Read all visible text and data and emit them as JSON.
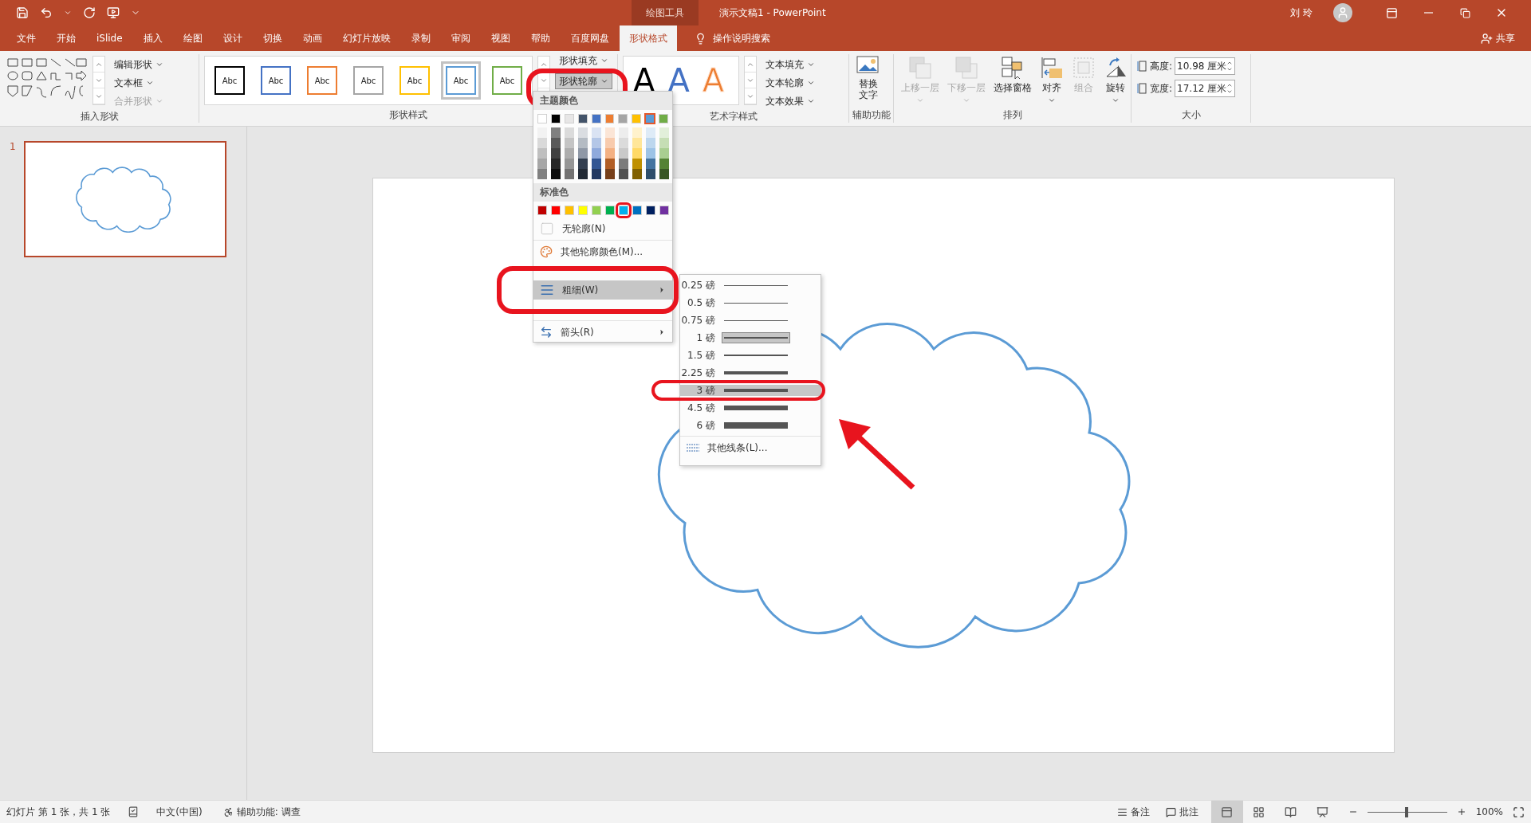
{
  "title_bar": {
    "contextual_tab": "绘图工具",
    "document_title": "演示文稿1  -  PowerPoint",
    "user_name": "刘 玲"
  },
  "tabs": [
    {
      "label": "文件",
      "selected": false
    },
    {
      "label": "开始",
      "selected": false
    },
    {
      "label": "iSlide",
      "selected": false
    },
    {
      "label": "插入",
      "selected": false
    },
    {
      "label": "绘图",
      "selected": false
    },
    {
      "label": "设计",
      "selected": false
    },
    {
      "label": "切换",
      "selected": false
    },
    {
      "label": "动画",
      "selected": false
    },
    {
      "label": "幻灯片放映",
      "selected": false
    },
    {
      "label": "录制",
      "selected": false
    },
    {
      "label": "审阅",
      "selected": false
    },
    {
      "label": "视图",
      "selected": false
    },
    {
      "label": "帮助",
      "selected": false
    },
    {
      "label": "百度网盘",
      "selected": false
    },
    {
      "label": "形状格式",
      "selected": true
    }
  ],
  "tell_me": "操作说明搜索",
  "share": "共享",
  "ribbon": {
    "insert_shapes": {
      "label": "插入形状",
      "commands": [
        {
          "label": "编辑形状",
          "disabled": false
        },
        {
          "label": "文本框",
          "disabled": false
        },
        {
          "label": "合并形状",
          "disabled": true
        }
      ]
    },
    "shape_styles": {
      "label": "形状样式",
      "styles": [
        {
          "label": "Abc",
          "color": "#000000",
          "selected": false
        },
        {
          "label": "Abc",
          "color": "#4472c4",
          "selected": false
        },
        {
          "label": "Abc",
          "color": "#ed7d31",
          "selected": false
        },
        {
          "label": "Abc",
          "color": "#a5a5a5",
          "selected": false
        },
        {
          "label": "Abc",
          "color": "#ffc000",
          "selected": false
        },
        {
          "label": "Abc",
          "color": "#5b9bd5",
          "selected": true
        },
        {
          "label": "Abc",
          "color": "#70ad47",
          "selected": false
        }
      ],
      "commands": [
        {
          "label": "形状填充",
          "pressed": false
        },
        {
          "label": "形状轮廓",
          "pressed": true
        }
      ]
    },
    "wordart_styles": {
      "label": "艺术字样式",
      "presets": [
        {
          "text": "A",
          "color": "#000000",
          "kind": "fill"
        },
        {
          "text": "A",
          "color": "#4472c4",
          "kind": "fill"
        },
        {
          "text": "A",
          "color": "#ed7d31",
          "kind": "outline"
        }
      ],
      "commands": [
        "文本填充",
        "文本轮廓",
        "文本效果"
      ]
    },
    "accessibility": {
      "label": "辅助功能",
      "command": "替换文字"
    },
    "arrange": {
      "label": "排列",
      "commands": [
        {
          "kind": "bring_forward",
          "label": "上移一层",
          "disabled": true,
          "dropdown": true
        },
        {
          "kind": "send_backward",
          "label": "下移一层",
          "disabled": true,
          "dropdown": true
        },
        {
          "kind": "selection_pane",
          "label": "选择窗格",
          "disabled": false,
          "dropdown": false
        },
        {
          "kind": "align",
          "label": "对齐",
          "disabled": false,
          "dropdown": true
        },
        {
          "kind": "group",
          "label": "组合",
          "disabled": true,
          "dropdown": false
        },
        {
          "kind": "rotate",
          "label": "旋转",
          "disabled": false,
          "dropdown": true
        }
      ]
    },
    "size": {
      "label": "大小",
      "fields": [
        {
          "label": "高度:",
          "value": "10.98 厘米"
        },
        {
          "label": "宽度:",
          "value": "17.12 厘米"
        }
      ]
    }
  },
  "slides_panel": {
    "slides": [
      {
        "number": "1",
        "selected": true
      }
    ]
  },
  "outline_menu": {
    "theme_heading": "主题颜色",
    "theme_colors": [
      {
        "color": "#ffffff",
        "selected": false
      },
      {
        "color": "#000000",
        "selected": false
      },
      {
        "color": "#e7e6e6",
        "selected": false
      },
      {
        "color": "#44546a",
        "selected": false
      },
      {
        "color": "#4472c4",
        "selected": false
      },
      {
        "color": "#ed7d31",
        "selected": false
      },
      {
        "color": "#a5a5a5",
        "selected": false
      },
      {
        "color": "#ffc000",
        "selected": false
      },
      {
        "color": "#5b9bd5",
        "selected": true
      },
      {
        "color": "#70ad47",
        "selected": false
      }
    ],
    "standard_heading": "标准色",
    "standard_colors": [
      {
        "color": "#c00000",
        "selected": false
      },
      {
        "color": "#ff0000",
        "selected": false
      },
      {
        "color": "#ffc000",
        "selected": false
      },
      {
        "color": "#ffff00",
        "selected": false
      },
      {
        "color": "#92d050",
        "selected": false
      },
      {
        "color": "#00b050",
        "selected": false
      },
      {
        "color": "#00b0f0",
        "selected": false
      },
      {
        "color": "#0070c0",
        "selected": false
      },
      {
        "color": "#002060",
        "selected": false
      },
      {
        "color": "#7030a0",
        "selected": false
      }
    ],
    "items": [
      {
        "kind": "no_outline",
        "label": "无轮廓(N)",
        "highlighted": false,
        "submenu": false
      },
      {
        "kind": "more_colors",
        "label": "其他轮廓颜色(M)...",
        "highlighted": false,
        "submenu": false
      },
      {
        "kind": "weight",
        "label": "粗细(W)",
        "highlighted": true,
        "submenu": true
      },
      {
        "kind": "arrows",
        "label": "箭头(R)",
        "highlighted": false,
        "submenu": true
      }
    ]
  },
  "weight_menu": {
    "items": [
      {
        "label": "0.25 磅",
        "current": false,
        "hovered": false
      },
      {
        "label": "0.5 磅",
        "current": false,
        "hovered": false
      },
      {
        "label": "0.75 磅",
        "current": false,
        "hovered": false
      },
      {
        "label": "1 磅",
        "current": true,
        "hovered": false
      },
      {
        "label": "1.5 磅",
        "current": false,
        "hovered": false
      },
      {
        "label": "2.25 磅",
        "current": false,
        "hovered": false
      },
      {
        "label": "3 磅",
        "current": false,
        "hovered": true
      },
      {
        "label": "4.5 磅",
        "current": false,
        "hovered": false
      },
      {
        "label": "6 磅",
        "current": false,
        "hovered": false
      }
    ],
    "more": "其他线条(L)..."
  },
  "status_bar": {
    "slide_info": "幻灯片 第 1 张，共 1 张",
    "language": "中文(中国)",
    "accessibility": "辅助功能: 调查",
    "notes": "备注",
    "comments": "批注",
    "views": [
      {
        "kind": "normal",
        "selected": true
      },
      {
        "kind": "sorter",
        "selected": false
      },
      {
        "kind": "reading",
        "selected": false
      },
      {
        "kind": "slideshow",
        "selected": false
      }
    ],
    "zoom": {
      "level": 0.49
    },
    "zoom_text": "100%"
  }
}
